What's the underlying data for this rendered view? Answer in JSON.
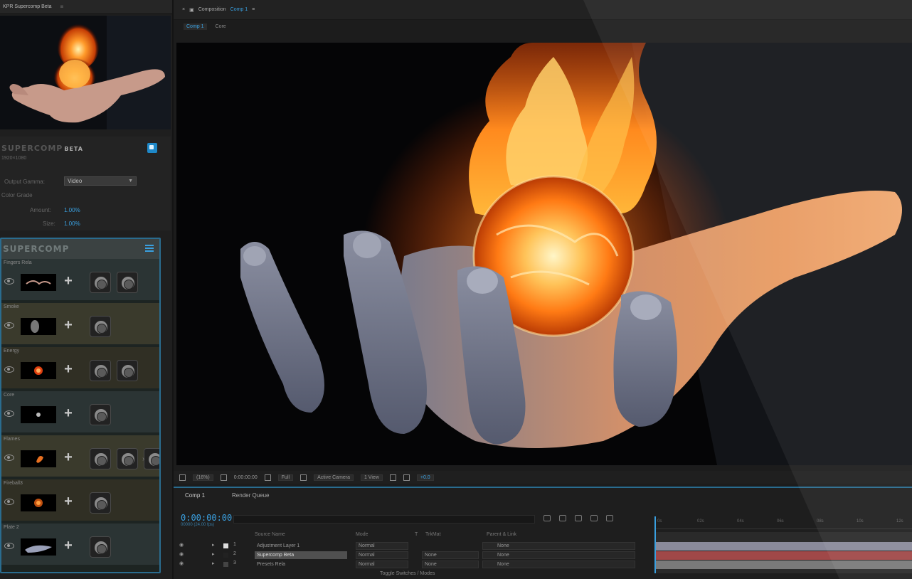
{
  "left_panel": {
    "tab_title": "KPR Supercomp Beta",
    "supercomp_info": {
      "brand": "SUPERCOMP",
      "badge": "BETA",
      "resolution": "1920×1080",
      "output_gamma_label": "Output Gamma:",
      "output_gamma_value": "Video",
      "section_label": "Color Grade",
      "amount_label": "Amount:",
      "amount_value": "1.00%",
      "size_label": "Size:",
      "size_value": "1.00%"
    },
    "layers_panel": {
      "header": "SUPERCOMP",
      "cards": [
        {
          "title": "Fingers Rela",
          "tools": 2
        },
        {
          "title": "Smoke",
          "tools": 1
        },
        {
          "title": "Energy",
          "tools": 2
        },
        {
          "title": "Core",
          "tools": 1
        },
        {
          "title": "Flames",
          "tools": 3
        },
        {
          "title": "Fireball3",
          "tools": 1
        },
        {
          "title": "Plate 2",
          "tools": 1
        }
      ]
    }
  },
  "composition": {
    "header_label": "Composition",
    "comp_name": "Comp 1",
    "breadcrumb_active": "Comp 1",
    "breadcrumb_other": "Core",
    "toolbar": {
      "zoom": "(16%)",
      "timecode": "0:00:00:00",
      "resolution": "Full",
      "camera": "Active Camera",
      "view": "1 View",
      "exposure": "+0.0"
    }
  },
  "timeline": {
    "tab_comp": "Comp 1",
    "tab_render": "Render Queue",
    "timecode": "0:00:00:00",
    "timecode_sub": "00000 (24.00 fps)",
    "col_source": "Source Name",
    "col_mode": "Mode",
    "col_t": "T",
    "col_trkmat": "TrkMat",
    "col_parent": "Parent & Link",
    "layers": [
      {
        "num": "1",
        "name": "Adjustment Layer 1",
        "mode": "Normal",
        "trkmat": "",
        "parent": "None",
        "swatch": "#ddd"
      },
      {
        "num": "2",
        "name": "Supercomp Beta",
        "mode": "Normal",
        "trkmat": "None",
        "parent": "None",
        "swatch": "#222"
      },
      {
        "num": "3",
        "name": "Presets Rela",
        "mode": "Normal",
        "trkmat": "None",
        "parent": "None",
        "swatch": "#444"
      }
    ],
    "ruler_ticks": [
      "0s",
      "02s",
      "04s",
      "06s",
      "08s",
      "10s",
      "12s"
    ],
    "footer": "Toggle Switches / Modes"
  },
  "colors": {
    "accent": "#3aa0e0",
    "panel_border": "#2a6c8f",
    "bar_adjust": "#8a8a9a",
    "bar_supercomp": "#a04848",
    "bar_preset": "#7a7a7a"
  }
}
